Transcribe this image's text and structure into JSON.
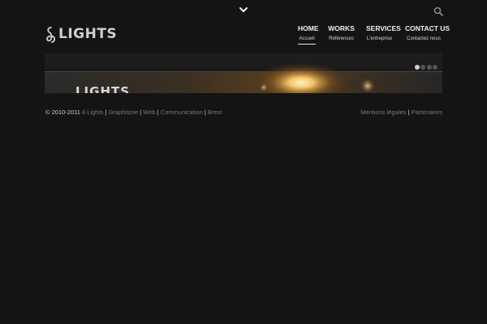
{
  "header": {
    "logo_text": "LIGHTS",
    "logo_brand": "8 Lights"
  },
  "nav": {
    "items": [
      {
        "title": "HOME",
        "subtitle": "Accueil",
        "active": true
      },
      {
        "title": "WORKS",
        "subtitle": "Références",
        "active": false
      },
      {
        "title": "SERVICES",
        "subtitle": "L'entreprise",
        "active": false
      },
      {
        "title": "CONTACT US",
        "subtitle": "Contactez nous",
        "active": false
      }
    ]
  },
  "slider": {
    "slide_count": 4,
    "active_index": 0,
    "banner_text": "LIGHTS"
  },
  "footer": {
    "copyright": "© 2010-2011",
    "links_left": [
      "8 Lights",
      "Graphisme",
      "Web",
      "Communication",
      "Brest"
    ],
    "links_right": [
      "Mentions légales",
      "Partenaires"
    ]
  },
  "colors": {
    "background": "#141414",
    "nav_text": "#f0f0f0",
    "link_gray": "#7a7a7a",
    "light_glow": "#f5c46a"
  },
  "icons": {
    "toggle": "chevron-down-icon",
    "search": "search-icon",
    "logo": "hook-icon"
  }
}
